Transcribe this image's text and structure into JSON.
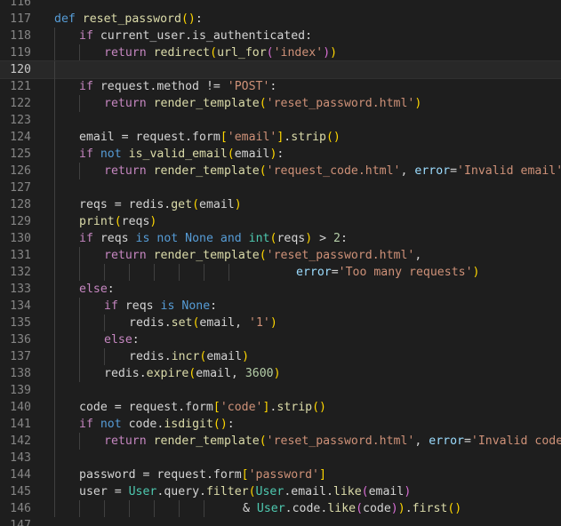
{
  "editor": {
    "language": "python",
    "current_line": 120,
    "colors": {
      "background": "#1e1e1e",
      "keyword": "#569cd6",
      "control": "#c586c0",
      "function": "#dcdcaa",
      "string": "#ce9178",
      "number": "#b5cea8",
      "parameter": "#9cdcfe",
      "class": "#4ec9b0",
      "bracket_1": "#ffd700",
      "bracket_2": "#da70d6",
      "bracket_3": "#179fff"
    },
    "lines": [
      {
        "n": "116",
        "indent": 0,
        "tokens": []
      },
      {
        "n": "117",
        "indent": 0,
        "tokens": [
          [
            "kw",
            "def"
          ],
          [
            "def",
            " "
          ],
          [
            "fn",
            "reset_password"
          ],
          [
            "b1",
            "()"
          ],
          [
            "def",
            ":"
          ]
        ]
      },
      {
        "n": "118",
        "indent": 1,
        "tokens": [
          [
            "ctl",
            "if"
          ],
          [
            "def",
            " current_user.is_authenticated:"
          ]
        ]
      },
      {
        "n": "119",
        "indent": 2,
        "tokens": [
          [
            "ctl",
            "return"
          ],
          [
            "def",
            " "
          ],
          [
            "fn",
            "redirect"
          ],
          [
            "b1",
            "("
          ],
          [
            "fn",
            "url_for"
          ],
          [
            "b2",
            "("
          ],
          [
            "str",
            "'index'"
          ],
          [
            "b2",
            ")"
          ],
          [
            "b1",
            ")"
          ]
        ]
      },
      {
        "n": "120",
        "indent": 1,
        "tokens": []
      },
      {
        "n": "121",
        "indent": 1,
        "tokens": [
          [
            "ctl",
            "if"
          ],
          [
            "def",
            " request.method "
          ],
          [
            "op",
            "!="
          ],
          [
            "def",
            " "
          ],
          [
            "str",
            "'POST'"
          ],
          [
            "def",
            ":"
          ]
        ]
      },
      {
        "n": "122",
        "indent": 2,
        "tokens": [
          [
            "ctl",
            "return"
          ],
          [
            "def",
            " "
          ],
          [
            "fn",
            "render_template"
          ],
          [
            "b1",
            "("
          ],
          [
            "str",
            "'reset_password.html'"
          ],
          [
            "b1",
            ")"
          ]
        ]
      },
      {
        "n": "123",
        "indent": 1,
        "tokens": []
      },
      {
        "n": "124",
        "indent": 1,
        "tokens": [
          [
            "def",
            "email "
          ],
          [
            "op",
            "="
          ],
          [
            "def",
            " request.form"
          ],
          [
            "b1",
            "["
          ],
          [
            "str",
            "'email'"
          ],
          [
            "b1",
            "]"
          ],
          [
            "def",
            "."
          ],
          [
            "fn",
            "strip"
          ],
          [
            "b1",
            "()"
          ]
        ]
      },
      {
        "n": "125",
        "indent": 1,
        "tokens": [
          [
            "ctl",
            "if"
          ],
          [
            "def",
            " "
          ],
          [
            "kw",
            "not"
          ],
          [
            "def",
            " "
          ],
          [
            "fn",
            "is_valid_email"
          ],
          [
            "b1",
            "("
          ],
          [
            "def",
            "email"
          ],
          [
            "b1",
            ")"
          ],
          [
            "def",
            ":"
          ]
        ]
      },
      {
        "n": "126",
        "indent": 2,
        "tokens": [
          [
            "ctl",
            "return"
          ],
          [
            "def",
            " "
          ],
          [
            "fn",
            "render_template"
          ],
          [
            "b1",
            "("
          ],
          [
            "str",
            "'request_code.html'"
          ],
          [
            "def",
            ", "
          ],
          [
            "var",
            "error"
          ],
          [
            "op",
            "="
          ],
          [
            "str",
            "'Invalid email'"
          ],
          [
            "b1",
            ")"
          ]
        ]
      },
      {
        "n": "127",
        "indent": 1,
        "tokens": []
      },
      {
        "n": "128",
        "indent": 1,
        "tokens": [
          [
            "def",
            "reqs "
          ],
          [
            "op",
            "="
          ],
          [
            "def",
            " redis."
          ],
          [
            "fn",
            "get"
          ],
          [
            "b1",
            "("
          ],
          [
            "def",
            "email"
          ],
          [
            "b1",
            ")"
          ]
        ]
      },
      {
        "n": "129",
        "indent": 1,
        "tokens": [
          [
            "fn",
            "print"
          ],
          [
            "b1",
            "("
          ],
          [
            "def",
            "reqs"
          ],
          [
            "b1",
            ")"
          ]
        ]
      },
      {
        "n": "130",
        "indent": 1,
        "tokens": [
          [
            "ctl",
            "if"
          ],
          [
            "def",
            " reqs "
          ],
          [
            "kw",
            "is"
          ],
          [
            "def",
            " "
          ],
          [
            "kw",
            "not"
          ],
          [
            "def",
            " "
          ],
          [
            "kw",
            "None"
          ],
          [
            "def",
            " "
          ],
          [
            "kw",
            "and"
          ],
          [
            "def",
            " "
          ],
          [
            "cls",
            "int"
          ],
          [
            "b1",
            "("
          ],
          [
            "def",
            "reqs"
          ],
          [
            "b1",
            ")"
          ],
          [
            "def",
            " "
          ],
          [
            "op",
            ">"
          ],
          [
            "def",
            " "
          ],
          [
            "num",
            "2"
          ],
          [
            "def",
            ":"
          ]
        ]
      },
      {
        "n": "131",
        "indent": 2,
        "tokens": [
          [
            "ctl",
            "return"
          ],
          [
            "def",
            " "
          ],
          [
            "fn",
            "render_template"
          ],
          [
            "b1",
            "("
          ],
          [
            "str",
            "'reset_password.html'"
          ],
          [
            "def",
            ","
          ]
        ]
      },
      {
        "n": "132",
        "indent": 8,
        "pad": "      ",
        "tokens": [
          [
            "var",
            "error"
          ],
          [
            "op",
            "="
          ],
          [
            "str",
            "'Too many requests'"
          ],
          [
            "b1",
            ")"
          ]
        ]
      },
      {
        "n": "133",
        "indent": 1,
        "tokens": [
          [
            "ctl",
            "else"
          ],
          [
            "def",
            ":"
          ]
        ]
      },
      {
        "n": "134",
        "indent": 2,
        "tokens": [
          [
            "ctl",
            "if"
          ],
          [
            "def",
            " reqs "
          ],
          [
            "kw",
            "is"
          ],
          [
            "def",
            " "
          ],
          [
            "kw",
            "None"
          ],
          [
            "def",
            ":"
          ]
        ]
      },
      {
        "n": "135",
        "indent": 3,
        "tokens": [
          [
            "def",
            "redis."
          ],
          [
            "fn",
            "set"
          ],
          [
            "b1",
            "("
          ],
          [
            "def",
            "email, "
          ],
          [
            "str",
            "'1'"
          ],
          [
            "b1",
            ")"
          ]
        ]
      },
      {
        "n": "136",
        "indent": 2,
        "tokens": [
          [
            "ctl",
            "else"
          ],
          [
            "def",
            ":"
          ]
        ]
      },
      {
        "n": "137",
        "indent": 3,
        "tokens": [
          [
            "def",
            "redis."
          ],
          [
            "fn",
            "incr"
          ],
          [
            "b1",
            "("
          ],
          [
            "def",
            "email"
          ],
          [
            "b1",
            ")"
          ]
        ]
      },
      {
        "n": "138",
        "indent": 2,
        "tokens": [
          [
            "def",
            "redis."
          ],
          [
            "fn",
            "expire"
          ],
          [
            "b1",
            "("
          ],
          [
            "def",
            "email, "
          ],
          [
            "num",
            "3600"
          ],
          [
            "b1",
            ")"
          ]
        ]
      },
      {
        "n": "139",
        "indent": 1,
        "tokens": []
      },
      {
        "n": "140",
        "indent": 1,
        "tokens": [
          [
            "def",
            "code "
          ],
          [
            "op",
            "="
          ],
          [
            "def",
            " request.form"
          ],
          [
            "b1",
            "["
          ],
          [
            "str",
            "'code'"
          ],
          [
            "b1",
            "]"
          ],
          [
            "def",
            "."
          ],
          [
            "fn",
            "strip"
          ],
          [
            "b1",
            "()"
          ]
        ]
      },
      {
        "n": "141",
        "indent": 1,
        "tokens": [
          [
            "ctl",
            "if"
          ],
          [
            "def",
            " "
          ],
          [
            "kw",
            "not"
          ],
          [
            "def",
            " code."
          ],
          [
            "fn",
            "isdigit"
          ],
          [
            "b1",
            "()"
          ],
          [
            "def",
            ":"
          ]
        ]
      },
      {
        "n": "142",
        "indent": 2,
        "tokens": [
          [
            "ctl",
            "return"
          ],
          [
            "def",
            " "
          ],
          [
            "fn",
            "render_template"
          ],
          [
            "b1",
            "("
          ],
          [
            "str",
            "'reset_password.html'"
          ],
          [
            "def",
            ", "
          ],
          [
            "var",
            "error"
          ],
          [
            "op",
            "="
          ],
          [
            "str",
            "'Invalid code'"
          ],
          [
            "b1",
            ")"
          ]
        ]
      },
      {
        "n": "143",
        "indent": 1,
        "tokens": []
      },
      {
        "n": "144",
        "indent": 1,
        "tokens": [
          [
            "def",
            "password "
          ],
          [
            "op",
            "="
          ],
          [
            "def",
            " request.form"
          ],
          [
            "b1",
            "["
          ],
          [
            "str",
            "'password'"
          ],
          [
            "b1",
            "]"
          ]
        ]
      },
      {
        "n": "145",
        "indent": 1,
        "tokens": [
          [
            "def",
            "user "
          ],
          [
            "op",
            "="
          ],
          [
            "def",
            " "
          ],
          [
            "cls",
            "User"
          ],
          [
            "def",
            ".query."
          ],
          [
            "fn",
            "filter"
          ],
          [
            "b1",
            "("
          ],
          [
            "cls",
            "User"
          ],
          [
            "def",
            ".email."
          ],
          [
            "fn",
            "like"
          ],
          [
            "b2",
            "("
          ],
          [
            "def",
            "email"
          ],
          [
            "b2",
            ")"
          ]
        ]
      },
      {
        "n": "146",
        "indent": 7,
        "pad": "  ",
        "tokens": [
          [
            "op",
            "&"
          ],
          [
            "def",
            " "
          ],
          [
            "cls",
            "User"
          ],
          [
            "def",
            ".code."
          ],
          [
            "fn",
            "like"
          ],
          [
            "b2",
            "("
          ],
          [
            "def",
            "code"
          ],
          [
            "b2",
            ")"
          ],
          [
            "b1",
            ")"
          ],
          [
            "def",
            "."
          ],
          [
            "fn",
            "first"
          ],
          [
            "b1",
            "()"
          ]
        ]
      },
      {
        "n": "147",
        "indent": 0,
        "tokens": []
      }
    ]
  }
}
